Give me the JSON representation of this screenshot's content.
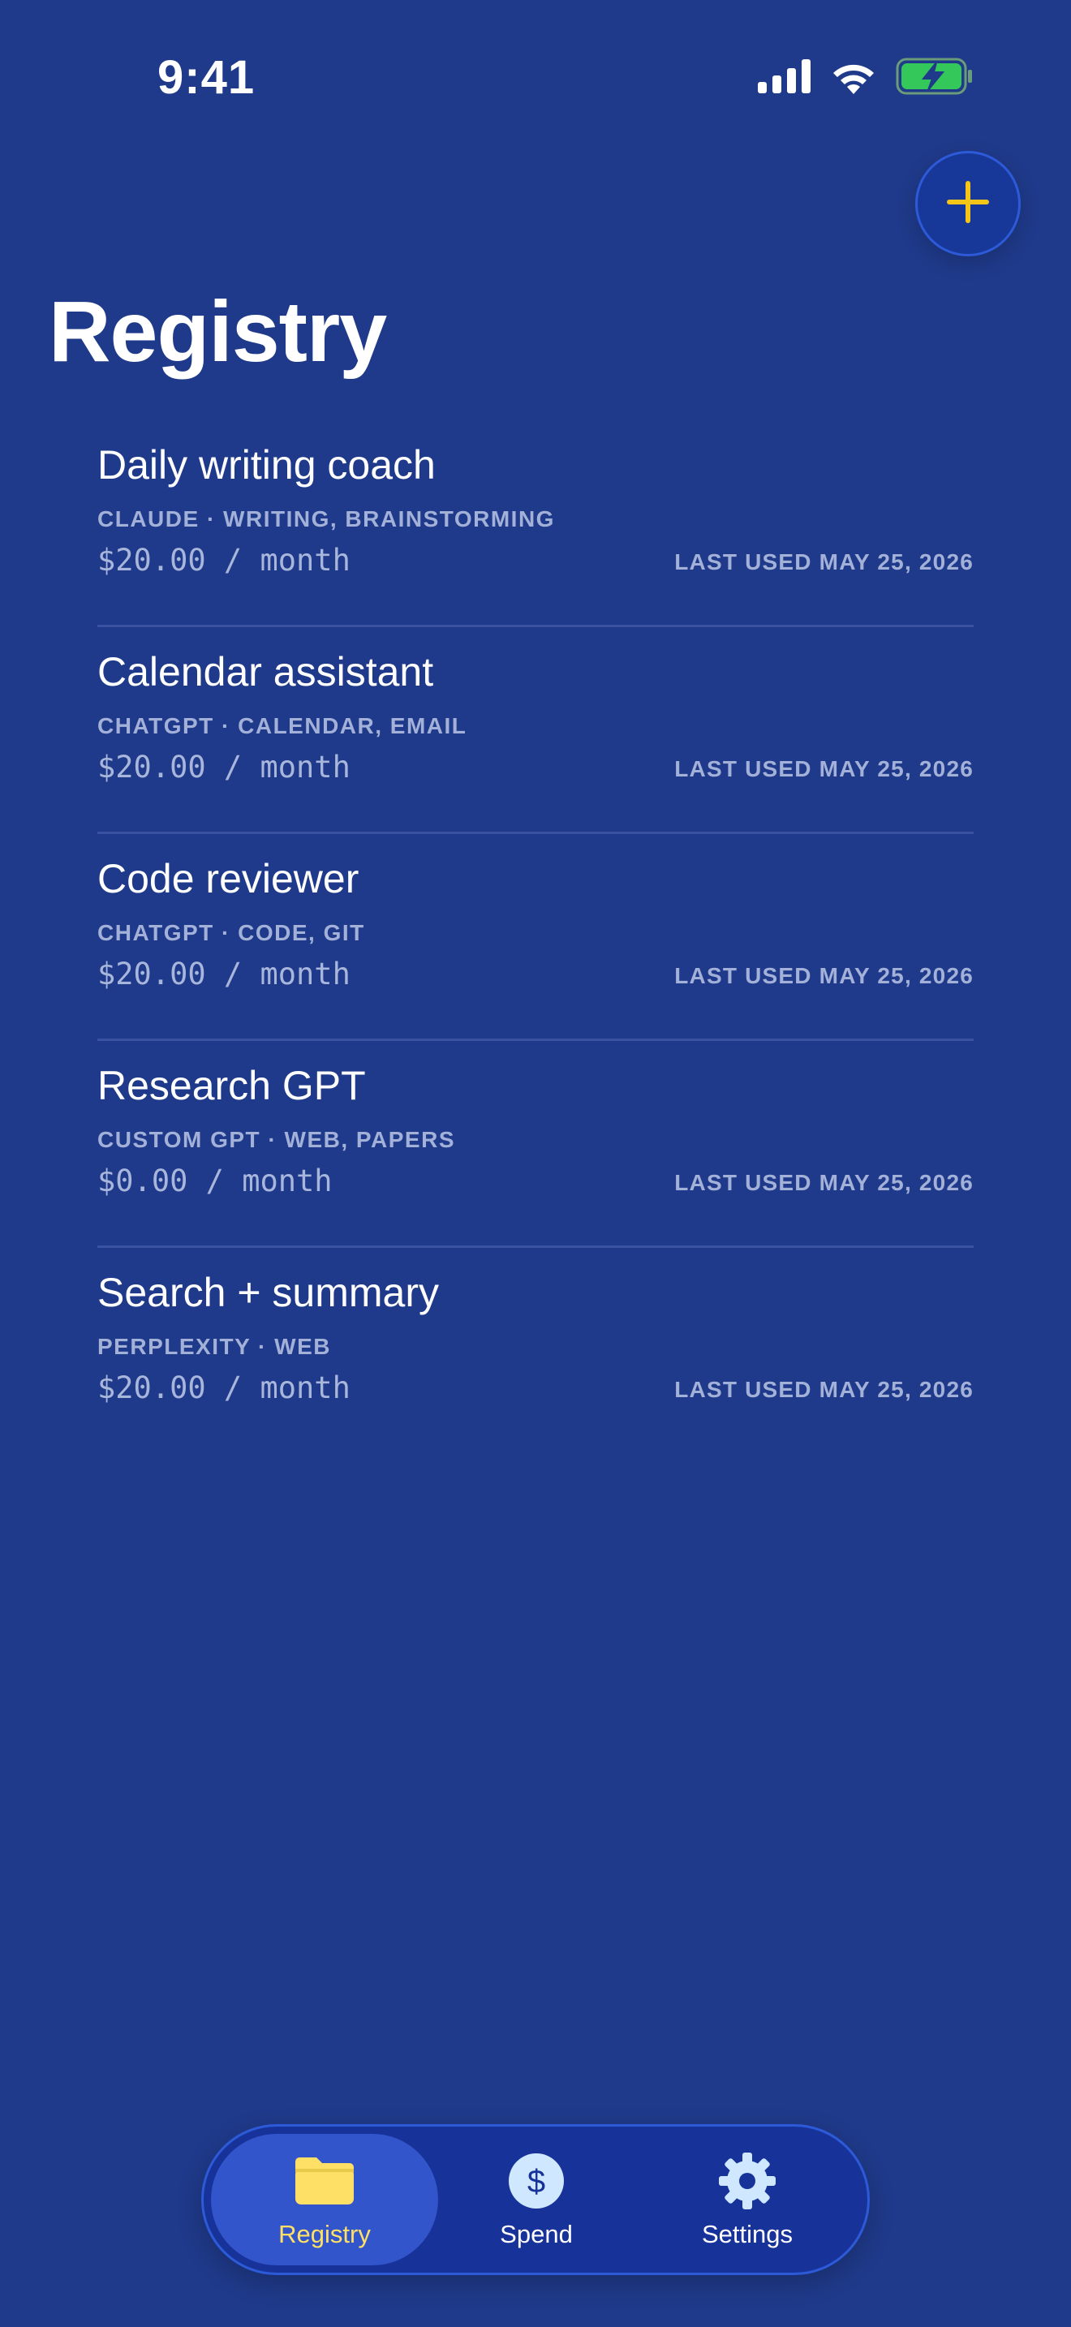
{
  "status_bar": {
    "time": "9:41",
    "icons": [
      "cellular-signal-icon",
      "wifi-icon",
      "battery-charging-icon"
    ]
  },
  "header": {
    "title": "Registry",
    "add_icon": "plus-icon"
  },
  "colors": {
    "background": "#1f3a8a",
    "accent_yellow": "#ffe066",
    "plus_yellow": "#f5c518",
    "battery_green": "#34c759",
    "muted_text": "#a3b1d9"
  },
  "registry": {
    "items": [
      {
        "name": "Daily writing coach",
        "meta": "CLAUDE · WRITING, BRAINSTORMING",
        "price": "$20.00 / month",
        "last_used": "LAST USED MAY 25, 2026"
      },
      {
        "name": "Calendar assistant",
        "meta": "CHATGPT · CALENDAR, EMAIL",
        "price": "$20.00 / month",
        "last_used": "LAST USED MAY 25, 2026"
      },
      {
        "name": "Code reviewer",
        "meta": "CHATGPT · CODE, GIT",
        "price": "$20.00 / month",
        "last_used": "LAST USED MAY 25, 2026"
      },
      {
        "name": "Research GPT",
        "meta": "CUSTOM GPT · WEB, PAPERS",
        "price": "$0.00 / month",
        "last_used": "LAST USED MAY 25, 2026"
      },
      {
        "name": "Search + summary",
        "meta": "PERPLEXITY · WEB",
        "price": "$20.00 / month",
        "last_used": "LAST USED MAY 25, 2026"
      }
    ]
  },
  "tab_bar": {
    "tabs": [
      {
        "label": "Registry",
        "icon": "folder-icon",
        "active": true
      },
      {
        "label": "Spend",
        "icon": "dollar-circle-icon",
        "active": false
      },
      {
        "label": "Settings",
        "icon": "gear-icon",
        "active": false
      }
    ]
  }
}
